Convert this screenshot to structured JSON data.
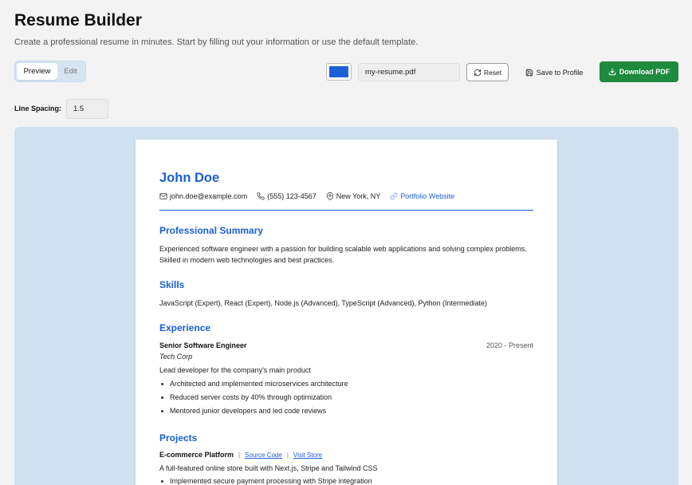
{
  "app": {
    "title": "Resume Builder",
    "subtitle": "Create a professional resume in minutes. Start by filling out your information or use the default template."
  },
  "mode_toggle": {
    "preview_label": "Preview",
    "edit_label": "Edit",
    "active": "Preview"
  },
  "toolbar": {
    "accent_color": "#1a5fd6",
    "filename_value": "my-resume.pdf",
    "reset_label": "Reset",
    "save_label": "Save to Profile",
    "download_label": "Download PDF",
    "download_color": "#1d8a3e"
  },
  "line_spacing": {
    "label": "Line Spacing:",
    "value": "1.5"
  },
  "resume": {
    "name": "John Doe",
    "contact": {
      "email": "john.doe@example.com",
      "phone": "(555) 123-4567",
      "location": "New York, NY",
      "website": "Portfolio Website"
    },
    "summary": {
      "title": "Professional Summary",
      "text": "Experienced software engineer with a passion for building scalable web applications and solving complex problems. Skilled in modern web technologies and best practices."
    },
    "skills": {
      "title": "Skills",
      "text": "JavaScript (Expert), React (Expert), Node.js (Advanced), TypeScript (Advanced), Python (Intermediate)"
    },
    "experience": {
      "title": "Experience",
      "jobs": [
        {
          "title": "Senior Software Engineer",
          "dates": "2020 - Present",
          "company": "Tech Corp",
          "description": "Lead developer for the company's main product",
          "bullets": [
            "Architected and implemented microservices architecture",
            "Reduced server costs by 40% through optimization",
            "Mentored junior developers and led code reviews"
          ]
        }
      ]
    },
    "projects": {
      "title": "Projects",
      "items": [
        {
          "name": "E-commerce Platform",
          "source_label": "Source Code",
          "store_label": "Visit Store",
          "separator": "|",
          "description": "A full-featured online store built with Next.js, Stripe and Tailwind CSS",
          "bullets": [
            "Implemented secure payment processing with Stripe integration"
          ]
        }
      ]
    }
  }
}
